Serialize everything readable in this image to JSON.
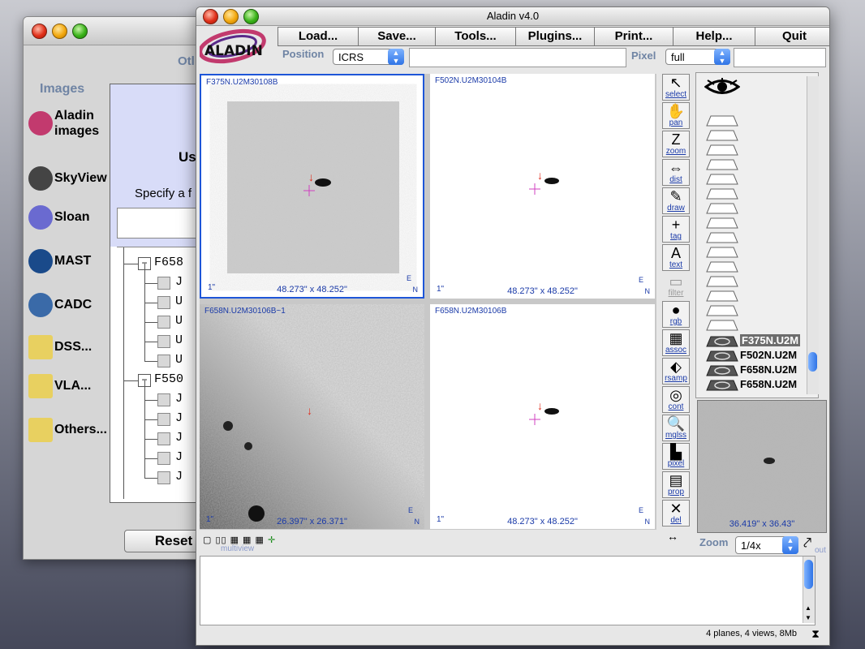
{
  "background_window": {
    "partial_label": "Otl",
    "images_heading": "Images",
    "servers": [
      {
        "label": "Aladin images",
        "icon": "aladin-galaxy-icon"
      },
      {
        "label": "SkyView",
        "icon": "telescope-icon"
      },
      {
        "label": "Sloan",
        "icon": "sloan-icon"
      },
      {
        "label": "MAST",
        "icon": "mast-icon"
      },
      {
        "label": "CADC",
        "icon": "cadc-icon"
      },
      {
        "label": "DSS...",
        "icon": "folder-icon"
      },
      {
        "label": "VLA...",
        "icon": "folder-icon"
      },
      {
        "label": "Others...",
        "icon": "folder-icon"
      }
    ],
    "partial_heading": "Us",
    "specify_text": "Specify a f",
    "tree_nodes": [
      {
        "label": "F658",
        "kind": "group"
      },
      {
        "label": "J",
        "kind": "leaf"
      },
      {
        "label": "U",
        "kind": "leaf"
      },
      {
        "label": "U",
        "kind": "leaf"
      },
      {
        "label": "U",
        "kind": "leaf"
      },
      {
        "label": "U",
        "kind": "leaf"
      },
      {
        "label": "F550",
        "kind": "group"
      },
      {
        "label": "J",
        "kind": "leaf"
      },
      {
        "label": "J",
        "kind": "leaf"
      },
      {
        "label": "J",
        "kind": "leaf"
      },
      {
        "label": "J",
        "kind": "leaf"
      },
      {
        "label": "J",
        "kind": "leaf"
      }
    ],
    "reset_label": "Reset"
  },
  "window": {
    "title": "Aladin v4.0",
    "logo_text": "ALADIN",
    "menu": [
      "Load...",
      "Save...",
      "Tools...",
      "Plugins...",
      "Print...",
      "Help...",
      "Quit"
    ],
    "position_label": "Position",
    "frame_select": "ICRS",
    "pixel_label": "Pixel",
    "pixel_select": "full"
  },
  "views": [
    {
      "label": "F375N.U2M30108B",
      "size": "48.273\" x 48.252\"",
      "scale": "1\"",
      "selected": true
    },
    {
      "label": "F502N.U2M30104B",
      "size": "48.273\" x 48.252\"",
      "scale": "1\"",
      "selected": false
    },
    {
      "label": "F658N.U2M30106B~1",
      "size": "26.397\" x 26.371\"",
      "scale": "1\"",
      "selected": false
    },
    {
      "label": "F658N.U2M30106B",
      "size": "48.273\" x 48.252\"",
      "scale": "1\"",
      "selected": false
    }
  ],
  "compass": {
    "east": "E",
    "north": "N"
  },
  "tools": [
    {
      "label": "select",
      "glyph": "↖",
      "enabled": true
    },
    {
      "label": "pan",
      "glyph": "✋",
      "enabled": true
    },
    {
      "label": "zoom",
      "glyph": "Z",
      "enabled": true
    },
    {
      "label": "dist",
      "glyph": "⇔",
      "enabled": true
    },
    {
      "label": "draw",
      "glyph": "✎",
      "enabled": true
    },
    {
      "label": "tag",
      "glyph": "+",
      "enabled": true
    },
    {
      "label": "text",
      "glyph": "A",
      "enabled": true
    },
    {
      "label": "filter",
      "glyph": "▭",
      "enabled": false
    },
    {
      "label": "rgb",
      "glyph": "●",
      "enabled": true
    },
    {
      "label": "assoc",
      "glyph": "▦",
      "enabled": true
    },
    {
      "label": "rsamp",
      "glyph": "⬖",
      "enabled": true
    },
    {
      "label": "cont",
      "glyph": "◎",
      "enabled": true
    },
    {
      "label": "mglss",
      "glyph": "🔍",
      "enabled": true
    },
    {
      "label": "pixel",
      "glyph": "▙",
      "enabled": true
    },
    {
      "label": "prop",
      "glyph": "▤",
      "enabled": true
    },
    {
      "label": "del",
      "glyph": "✕",
      "enabled": true
    }
  ],
  "planes": [
    {
      "name": "F375N.U2M",
      "selected": true
    },
    {
      "name": "F502N.U2M",
      "selected": false
    },
    {
      "name": "F658N.U2M",
      "selected": false
    },
    {
      "name": "F658N.U2M",
      "selected": false
    }
  ],
  "zoom_view_size": "36.419\" x 36.43\"",
  "multiview_label": "multiview",
  "zoom_label": "Zoom",
  "zoom_select": "1/4x",
  "zoom_out_label": "out",
  "status": "4 planes, 4 views, 8Mb",
  "colors": {
    "selection_border": "#1e56d8",
    "label_blue": "#1a3aa8",
    "heading_blue": "#6f84a4"
  }
}
